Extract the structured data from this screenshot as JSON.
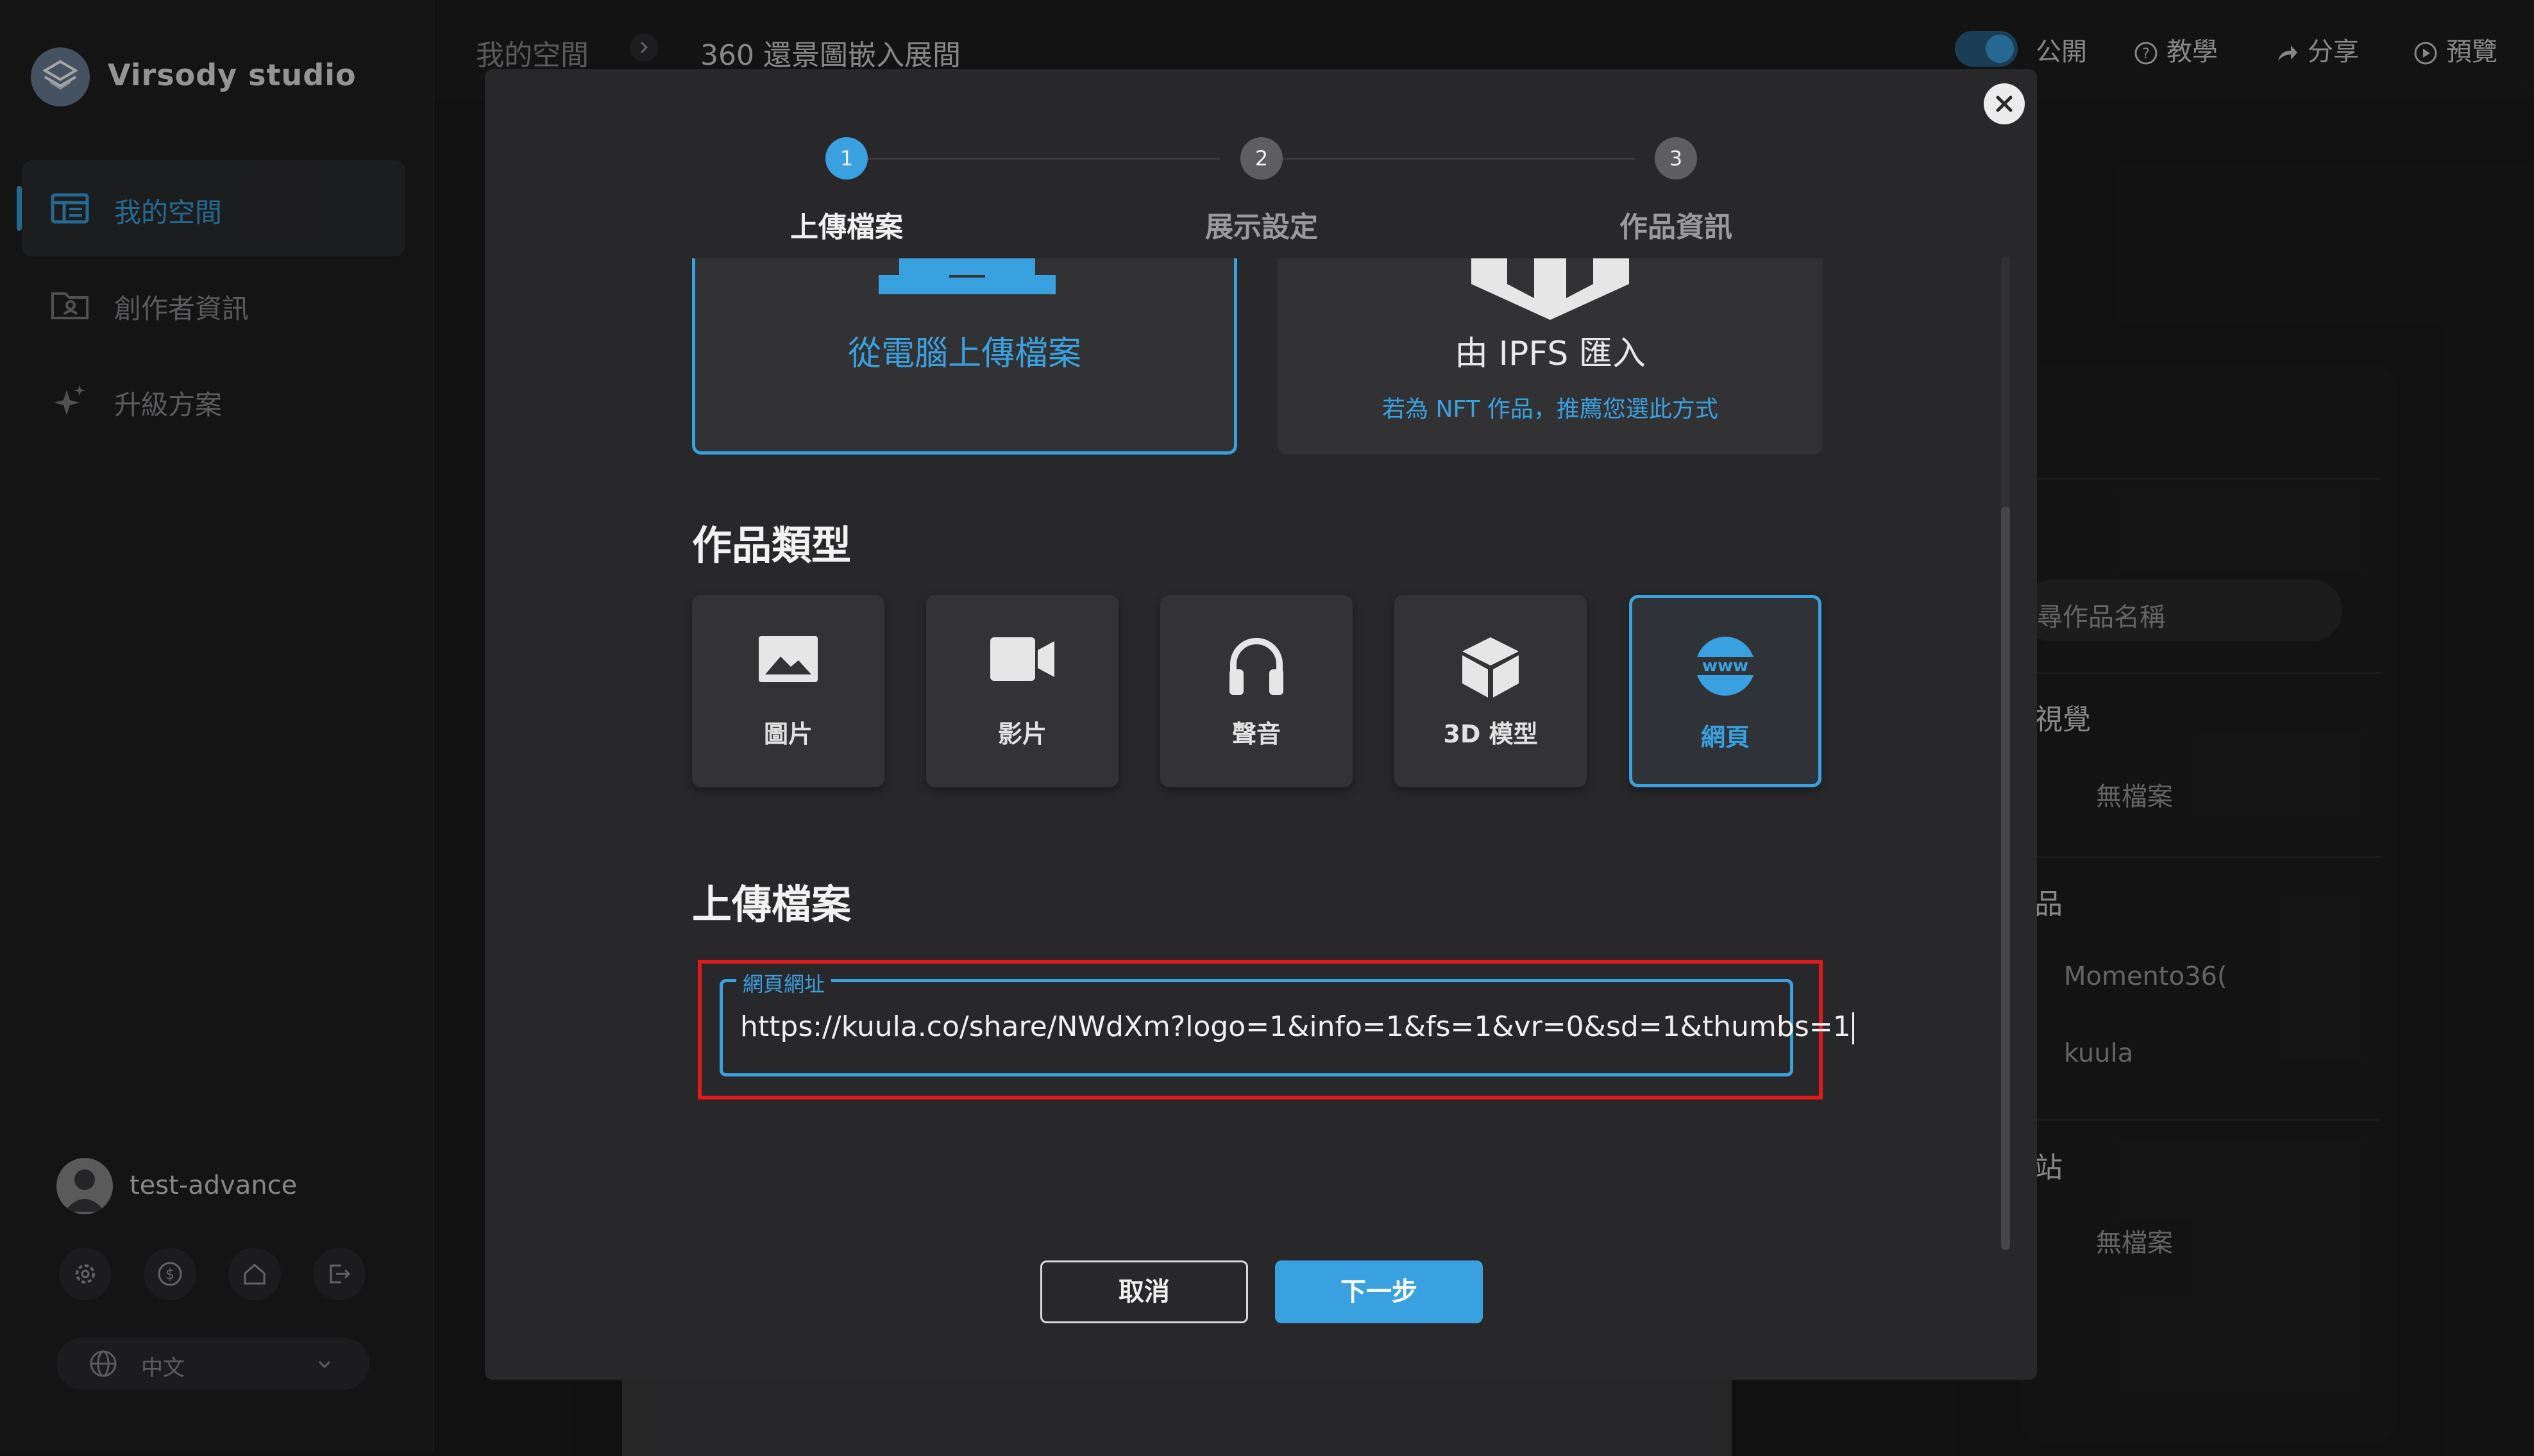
{
  "app": {
    "brand": "Virsody studio"
  },
  "sidebar": {
    "items": [
      {
        "label": "我的空間",
        "active": true
      },
      {
        "label": "創作者資訊",
        "active": false
      },
      {
        "label": "升級方案",
        "active": false
      }
    ],
    "user": {
      "name": "test-advance"
    },
    "language": {
      "selected": "中文"
    }
  },
  "header": {
    "breadcrumb": [
      "我的空間",
      "360 還景圖嵌入展間"
    ],
    "public_label": "公開",
    "tutorial_label": "教學",
    "share_label": "分享",
    "preview_label": "預覽"
  },
  "background": {
    "search_placeholder": "尋作品名稱",
    "section_visual": "視覺",
    "no_file_1": "無檔案",
    "section_works": "品",
    "item_1": "Momento36(",
    "item_2": "kuula",
    "section_site": "站",
    "no_file_2": "無檔案"
  },
  "modal": {
    "steps": [
      {
        "num": "1",
        "label": "上傳檔案",
        "active": true
      },
      {
        "num": "2",
        "label": "展示設定",
        "active": false
      },
      {
        "num": "3",
        "label": "作品資訊",
        "active": false
      }
    ],
    "upload_options": {
      "computer": {
        "title": "從電腦上傳檔案"
      },
      "ipfs": {
        "title": "由 IPFS 匯入",
        "subtitle": "若為 NFT 作品，推薦您選此方式"
      }
    },
    "type_section_title": "作品類型",
    "types": [
      {
        "label": "圖片",
        "icon": "image-icon",
        "selected": false
      },
      {
        "label": "影片",
        "icon": "video-icon",
        "selected": false
      },
      {
        "label": "聲音",
        "icon": "headphones-icon",
        "selected": false
      },
      {
        "label": "3D 模型",
        "icon": "cube-icon",
        "selected": false
      },
      {
        "label": "網頁",
        "icon": "www-icon",
        "selected": true
      }
    ],
    "upload_section_title": "上傳檔案",
    "url_field": {
      "legend": "網頁網址",
      "value": "https://kuula.co/share/NWdXm?logo=1&info=1&fs=1&vr=0&sd=1&thumbs=1"
    },
    "cancel_label": "取消",
    "next_label": "下一步"
  },
  "colors": {
    "accent": "#3aa1e0",
    "highlight": "#e01a1a",
    "modal_bg": "#28282a"
  }
}
